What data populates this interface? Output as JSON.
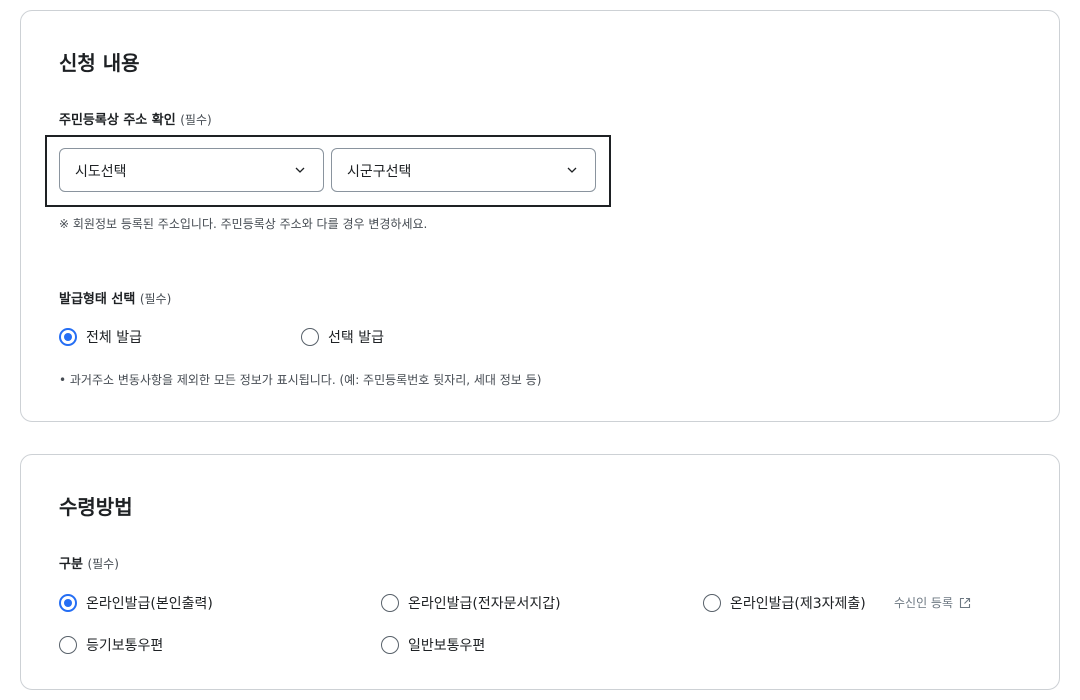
{
  "application": {
    "title": "신청 내용",
    "address": {
      "label": "주민등록상 주소 확인",
      "required": "(필수)",
      "sido_value": "시도선택",
      "sigungu_value": "시군구선택",
      "note": "※ 회원정보 등록된 주소입니다. 주민등록상 주소와 다를 경우 변경하세요."
    },
    "issue_type": {
      "label": "발급형태 선택",
      "required": "(필수)",
      "options": [
        {
          "label": "전체 발급",
          "checked": true
        },
        {
          "label": "선택 발급",
          "checked": false
        }
      ],
      "note": "• 과거주소 변동사항을 제외한 모든 정보가 표시됩니다. (예: 주민등록번호 뒷자리, 세대 정보 등)"
    }
  },
  "receive": {
    "title": "수령방법",
    "label": "구분",
    "required": "(필수)",
    "options": [
      {
        "label": "온라인발급(본인출력)",
        "checked": true
      },
      {
        "label": "온라인발급(전자문서지갑)",
        "checked": false
      },
      {
        "label": "온라인발급(제3자제출)",
        "checked": false
      },
      {
        "label": "등기보통우편",
        "checked": false
      },
      {
        "label": "일반보통우편",
        "checked": false
      }
    ],
    "recipient_link": "수신인 등록"
  },
  "colors": {
    "accent": "#256ef4",
    "border": "#cdd1d5",
    "text": "#1e2124",
    "subtext": "#464c53"
  },
  "icons": {
    "chevron": "chevron-down-icon",
    "external": "external-link-icon"
  }
}
